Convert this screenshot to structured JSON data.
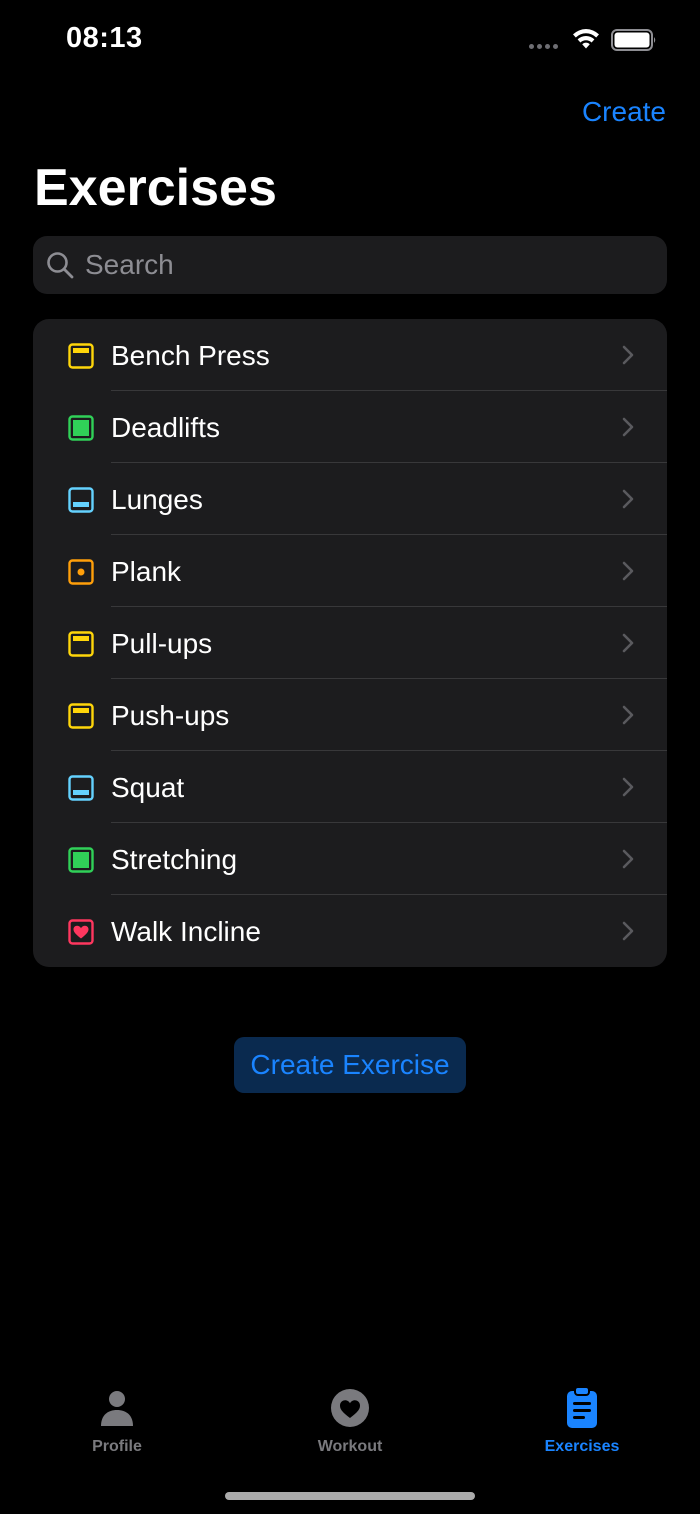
{
  "status_bar": {
    "time": "08:13",
    "icons": [
      "signal-dots-icon",
      "wifi-icon",
      "battery-icon"
    ]
  },
  "header": {
    "action_label": "Create",
    "title": "Exercises"
  },
  "search": {
    "placeholder": "Search",
    "value": "",
    "icon": "search-icon"
  },
  "exercises": [
    {
      "label": "Bench Press",
      "icon": "yellow-top-bar-square-icon",
      "color": "#ffd60a"
    },
    {
      "label": "Deadlifts",
      "icon": "green-filled-square-icon",
      "color": "#30d158"
    },
    {
      "label": "Lunges",
      "icon": "blue-bottom-bar-square-icon",
      "color": "#64d2ff"
    },
    {
      "label": "Plank",
      "icon": "orange-dot-square-icon",
      "color": "#ff9f0a"
    },
    {
      "label": "Pull-ups",
      "icon": "yellow-top-bar-square-icon",
      "color": "#ffd60a"
    },
    {
      "label": "Push-ups",
      "icon": "yellow-top-bar-square-icon",
      "color": "#ffd60a"
    },
    {
      "label": "Squat",
      "icon": "blue-bottom-bar-square-icon",
      "color": "#64d2ff"
    },
    {
      "label": "Stretching",
      "icon": "green-filled-square-icon",
      "color": "#30d158"
    },
    {
      "label": "Walk Incline",
      "icon": "pink-heart-square-icon",
      "color": "#ff375f"
    }
  ],
  "create_button": {
    "label": "Create Exercise"
  },
  "tabs": [
    {
      "label": "Profile",
      "icon": "person-icon",
      "active": false
    },
    {
      "label": "Workout",
      "icon": "heart-circle-icon",
      "active": false
    },
    {
      "label": "Exercises",
      "icon": "clipboard-icon",
      "active": true
    }
  ],
  "colors": {
    "accent": "#1a84ff",
    "background": "#000000",
    "card": "#1c1c1e",
    "inactive_tab": "#7a7a7e"
  }
}
